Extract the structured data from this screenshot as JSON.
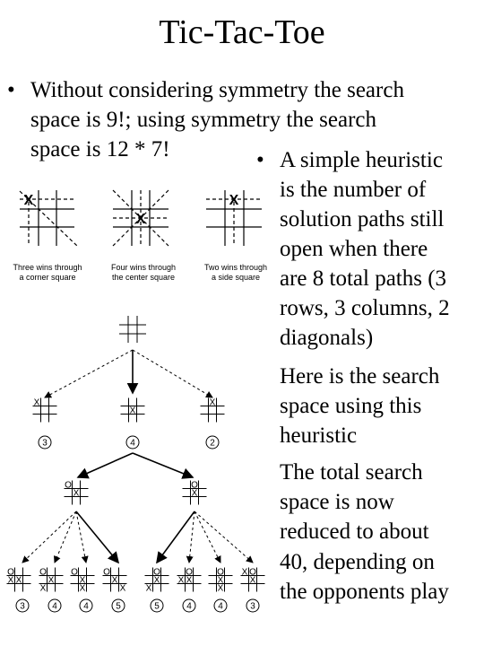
{
  "title": "Tic-Tac-Toe",
  "bullet1": [
    "Without considering symmetry the search",
    "space is 9!; using symmetry the search",
    "space is 12 * 7!"
  ],
  "bullet2": [
    "A simple heuristic",
    "is the number of",
    "solution paths still",
    "open when there",
    "are 8 total paths (3",
    "rows, 3 columns, 2",
    "diagonals)"
  ],
  "para3": [
    "Here is the search",
    "space using this",
    "heuristic"
  ],
  "para4": [
    "The total search",
    "space is now",
    "reduced to about",
    "40, depending on",
    "the opponents play"
  ],
  "symmetry_figure": {
    "captions": [
      [
        "Three wins through",
        "a corner square"
      ],
      [
        "Four wins through",
        "the center square"
      ],
      [
        "Two wins through",
        "a side square"
      ]
    ],
    "mark": "X"
  },
  "tree": {
    "root": "         ",
    "level1": [
      {
        "board": "X        ",
        "score": "3"
      },
      {
        "board": "    X    ",
        "score": "4"
      },
      {
        "board": " X       ",
        "score": "2"
      }
    ],
    "level2": [
      "O   X    ",
      " O  X    "
    ],
    "level3": [
      {
        "board": "O  XX    ",
        "score": "3"
      },
      {
        "board": "O   X X  ",
        "score": "4"
      },
      {
        "board": "O   X  X ",
        "score": "4"
      },
      {
        "board": "O   X   X",
        "score": "5"
      },
      {
        "board": " O  X X  ",
        "score": "5"
      },
      {
        "board": " O XX    ",
        "score": "4"
      },
      {
        "board": " O  X  X ",
        "score": "4"
      },
      {
        "board": "XO  X    ",
        "score": "3"
      }
    ]
  }
}
